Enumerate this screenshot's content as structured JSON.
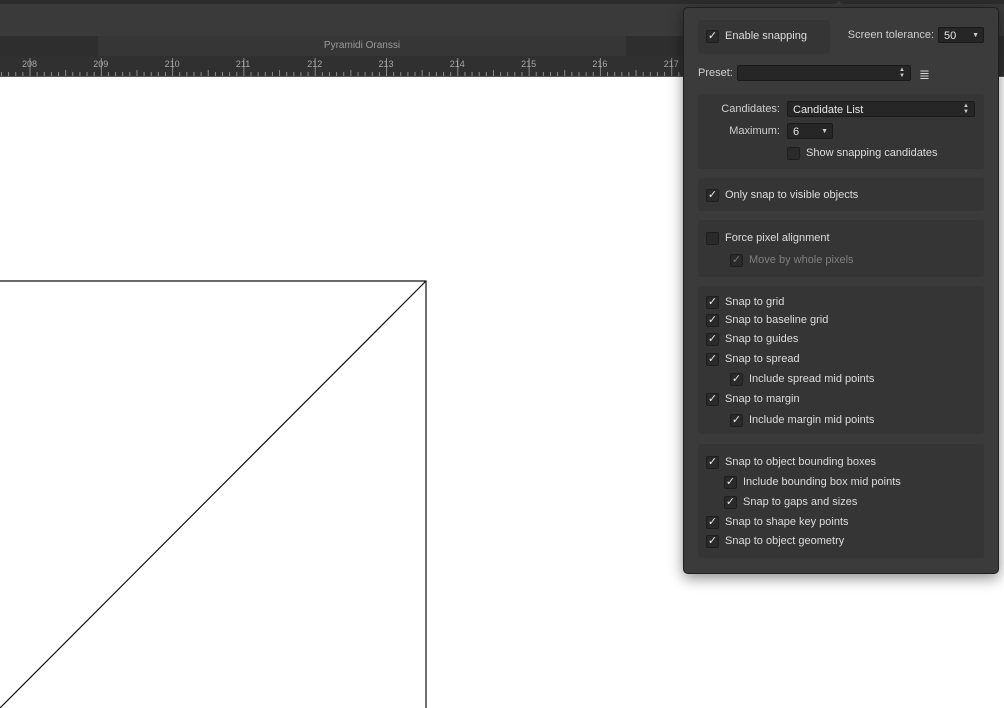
{
  "document": {
    "tab_title": "Pyramidi Oranssi"
  },
  "ruler": {
    "labels": [
      "208",
      "209",
      "210",
      "211",
      "212",
      "213",
      "214",
      "215",
      "216",
      "217"
    ]
  },
  "panel": {
    "enable_snapping": {
      "label": "Enable snapping",
      "checked": true
    },
    "screen_tolerance": {
      "label": "Screen tolerance:",
      "value": "50"
    },
    "preset": {
      "label": "Preset:",
      "value": ""
    },
    "candidates": {
      "label": "Candidates:",
      "value": "Candidate List"
    },
    "maximum": {
      "label": "Maximum:",
      "value": "6"
    },
    "show_candidates": {
      "label": "Show snapping candidates",
      "checked": false
    },
    "only_visible": {
      "label": "Only snap to visible objects",
      "checked": true
    },
    "force_pixel": {
      "label": "Force pixel alignment",
      "checked": false
    },
    "move_whole": {
      "label": "Move by whole pixels",
      "checked": true,
      "disabled": true
    },
    "grid_group": [
      {
        "label": "Snap to grid",
        "checked": true,
        "indent": false
      },
      {
        "label": "Snap to baseline grid",
        "checked": true,
        "indent": false
      },
      {
        "label": "Snap to guides",
        "checked": true,
        "indent": false
      },
      {
        "label": "Snap to spread",
        "checked": true,
        "indent": false
      },
      {
        "label": "Include spread mid points",
        "checked": true,
        "indent": true
      },
      {
        "label": "Snap to margin",
        "checked": true,
        "indent": false
      },
      {
        "label": "Include margin mid points",
        "checked": true,
        "indent": true
      }
    ],
    "object_group": [
      {
        "label": "Snap to object bounding boxes",
        "checked": true,
        "indent": false
      },
      {
        "label": "Include bounding box mid points",
        "checked": true,
        "indent": true
      },
      {
        "label": "Snap to gaps and sizes",
        "checked": true,
        "indent": true
      },
      {
        "label": "Snap to shape key points",
        "checked": true,
        "indent": false
      },
      {
        "label": "Snap to object geometry",
        "checked": true,
        "indent": false
      }
    ]
  }
}
